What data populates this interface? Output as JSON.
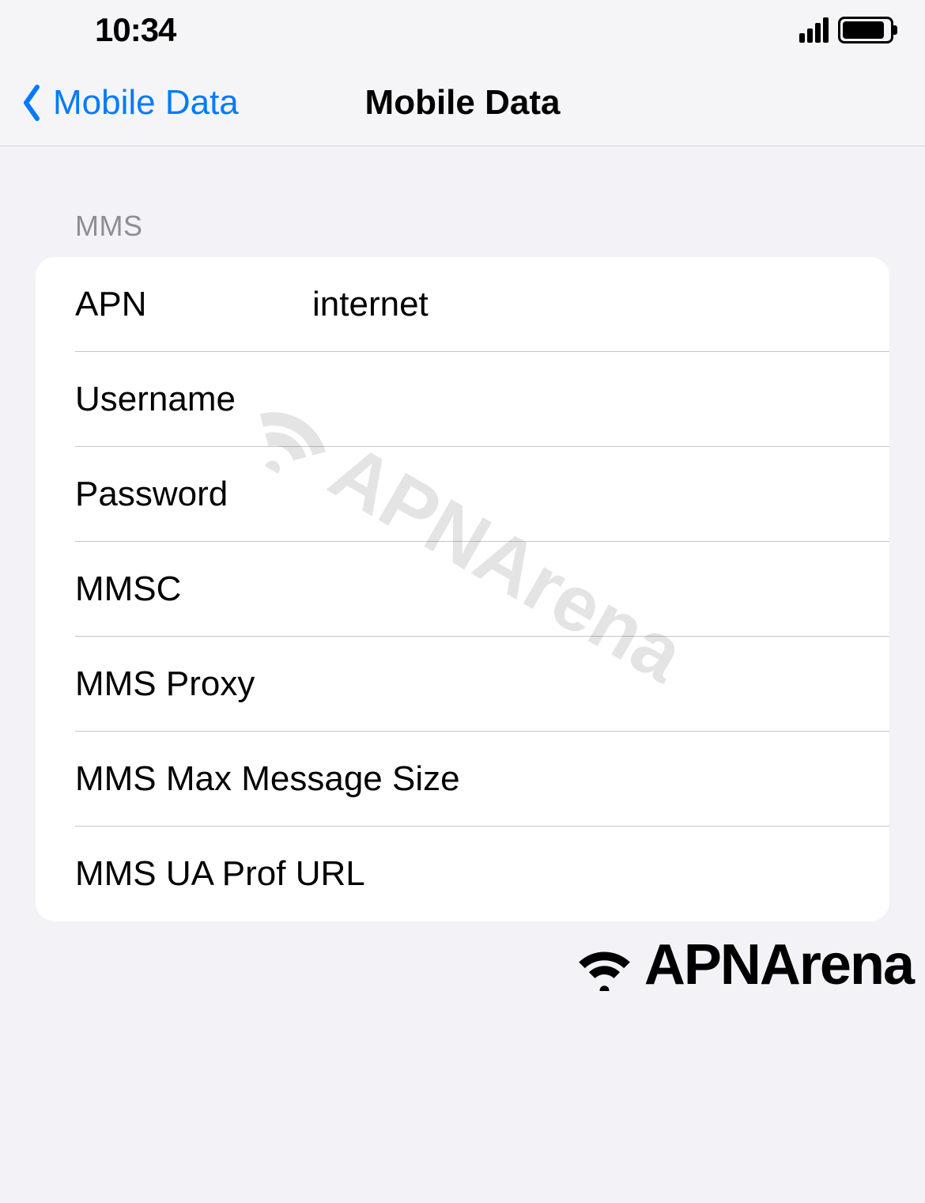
{
  "statusBar": {
    "time": "10:34"
  },
  "navBar": {
    "backLabel": "Mobile Data",
    "title": "Mobile Data"
  },
  "section": {
    "header": "MMS"
  },
  "fields": {
    "apn": {
      "label": "APN",
      "value": "internet"
    },
    "username": {
      "label": "Username",
      "value": ""
    },
    "password": {
      "label": "Password",
      "value": ""
    },
    "mmsc": {
      "label": "MMSC",
      "value": ""
    },
    "mmsProxy": {
      "label": "MMS Proxy",
      "value": ""
    },
    "mmsMaxSize": {
      "label": "MMS Max Message Size",
      "value": ""
    },
    "mmsUaProf": {
      "label": "MMS UA Prof URL",
      "value": ""
    }
  },
  "watermark": {
    "text": "APNArena"
  }
}
